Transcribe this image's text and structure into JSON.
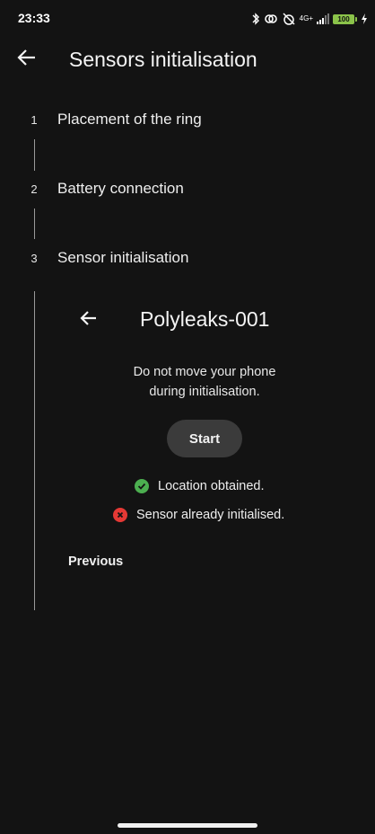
{
  "status_bar": {
    "time": "23:33",
    "network": "4G+",
    "battery": "100"
  },
  "app_bar": {
    "back_icon": "arrow-left-icon",
    "title": "Sensors initialisation"
  },
  "steps": [
    {
      "number": "1",
      "label": "Placement of the ring"
    },
    {
      "number": "2",
      "label": "Battery connection"
    },
    {
      "number": "3",
      "label": "Sensor initialisation"
    }
  ],
  "panel": {
    "back_icon": "arrow-left-icon",
    "title": "Polyleaks-001",
    "instruction_line1": "Do not move your phone",
    "instruction_line2": "during initialisation.",
    "start_label": "Start",
    "statuses": [
      {
        "icon": "check-circle-icon",
        "color": "#4caf50",
        "text": "Location obtained."
      },
      {
        "icon": "error-circle-icon",
        "color": "#e53935",
        "text": "Sensor already initialised."
      }
    ],
    "previous_label": "Previous"
  },
  "colors": {
    "background": "#131313",
    "step_line": "#9a9a9a",
    "button": "#3b3b3b",
    "success": "#4caf50",
    "error": "#e53935"
  }
}
